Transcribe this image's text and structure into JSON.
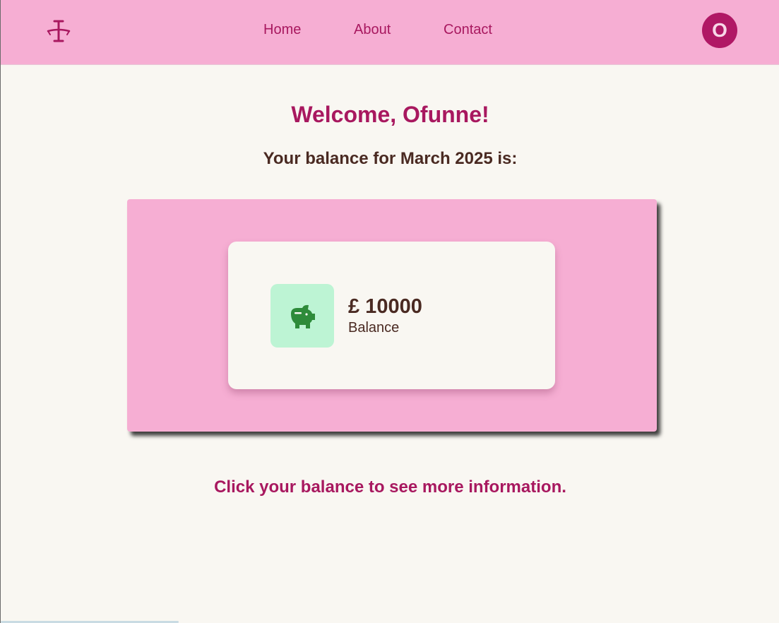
{
  "nav": {
    "logo_icon": "scales-icon",
    "links": [
      "Home",
      "About",
      "Contact"
    ],
    "avatar_initial": "O"
  },
  "main": {
    "welcome": "Welcome, Ofunne!",
    "balance_intro": "Your balance for March 2025 is:",
    "card": {
      "icon": "piggy-bank-icon",
      "amount": "£ 10000",
      "label": "Balance"
    },
    "hint": "Click your balance to see more information."
  },
  "colors": {
    "primary": "#a8185f",
    "header_bg": "#f6aed3",
    "page_bg": "#f9f7f2",
    "text_dark": "#4a2a22",
    "icon_bg": "#bdf4d4",
    "icon_fg": "#2e8b3a"
  }
}
